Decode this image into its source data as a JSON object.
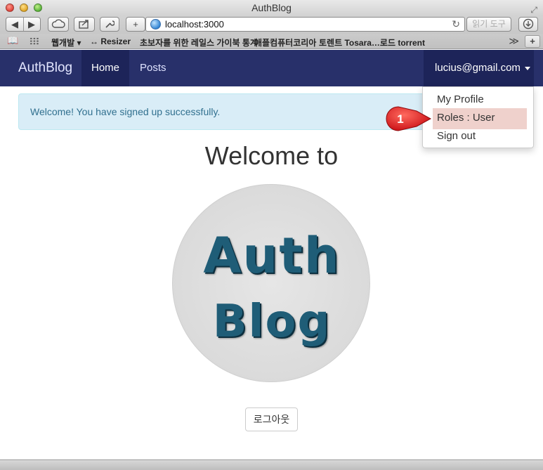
{
  "window": {
    "title": "AuthBlog"
  },
  "toolbar": {
    "back_icon": "◀",
    "forward_icon": "▶",
    "plus_label": "+",
    "url": "localhost:3000",
    "reader_label": "읽기 도구"
  },
  "bookmarks": {
    "items": [
      "웹개발 ▾",
      "↔ Resizer",
      "초보자를 위한 레일스 가이북 통계",
      "애플컴퓨터코리아",
      "토렌트 Tosara…로드 torrent"
    ]
  },
  "navbar": {
    "brand": "AuthBlog",
    "home": "Home",
    "posts": "Posts",
    "user_email": "lucius@gmail.com"
  },
  "dropdown": {
    "items": [
      "My Profile",
      "Roles : User",
      "Sign out"
    ]
  },
  "alert": {
    "message": "Welcome! You have signed up successfully."
  },
  "main": {
    "heading": "Welcome to",
    "logo_line1": "Auth",
    "logo_line2": "Blog",
    "logout_button": "로그아웃"
  },
  "callout": {
    "number": "1"
  },
  "colors": {
    "navbar": "#28306a",
    "navbar_active": "#1d2459",
    "alert_bg": "#d9edf7",
    "alert_text": "#31708f",
    "highlight": "#efd1cc",
    "callout_red": "#e3141b"
  }
}
